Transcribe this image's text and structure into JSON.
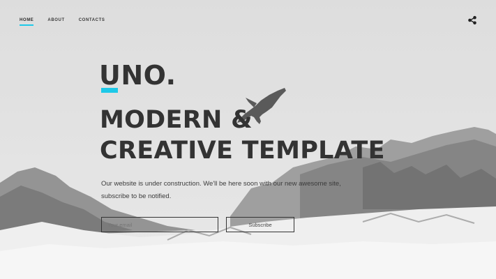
{
  "nav": {
    "items": [
      {
        "label": "HOME",
        "active": true
      },
      {
        "label": "ABOUT",
        "active": false
      },
      {
        "label": "CONTACTS",
        "active": false
      }
    ]
  },
  "share_icon": "share-icon",
  "brand": {
    "name": "UNO."
  },
  "headline": {
    "line1": "MODERN &",
    "line2": "CREATIVE TEMPLATE"
  },
  "tagline": {
    "line1": "Our website is under construction. We'll be here soon with our new awesome site,",
    "line2": "subscribe to be notified."
  },
  "subscribe_form": {
    "email_placeholder": "Your email",
    "button_label": "Subscribe"
  },
  "colors": {
    "accent": "#1ec9e8",
    "text": "#333333"
  }
}
